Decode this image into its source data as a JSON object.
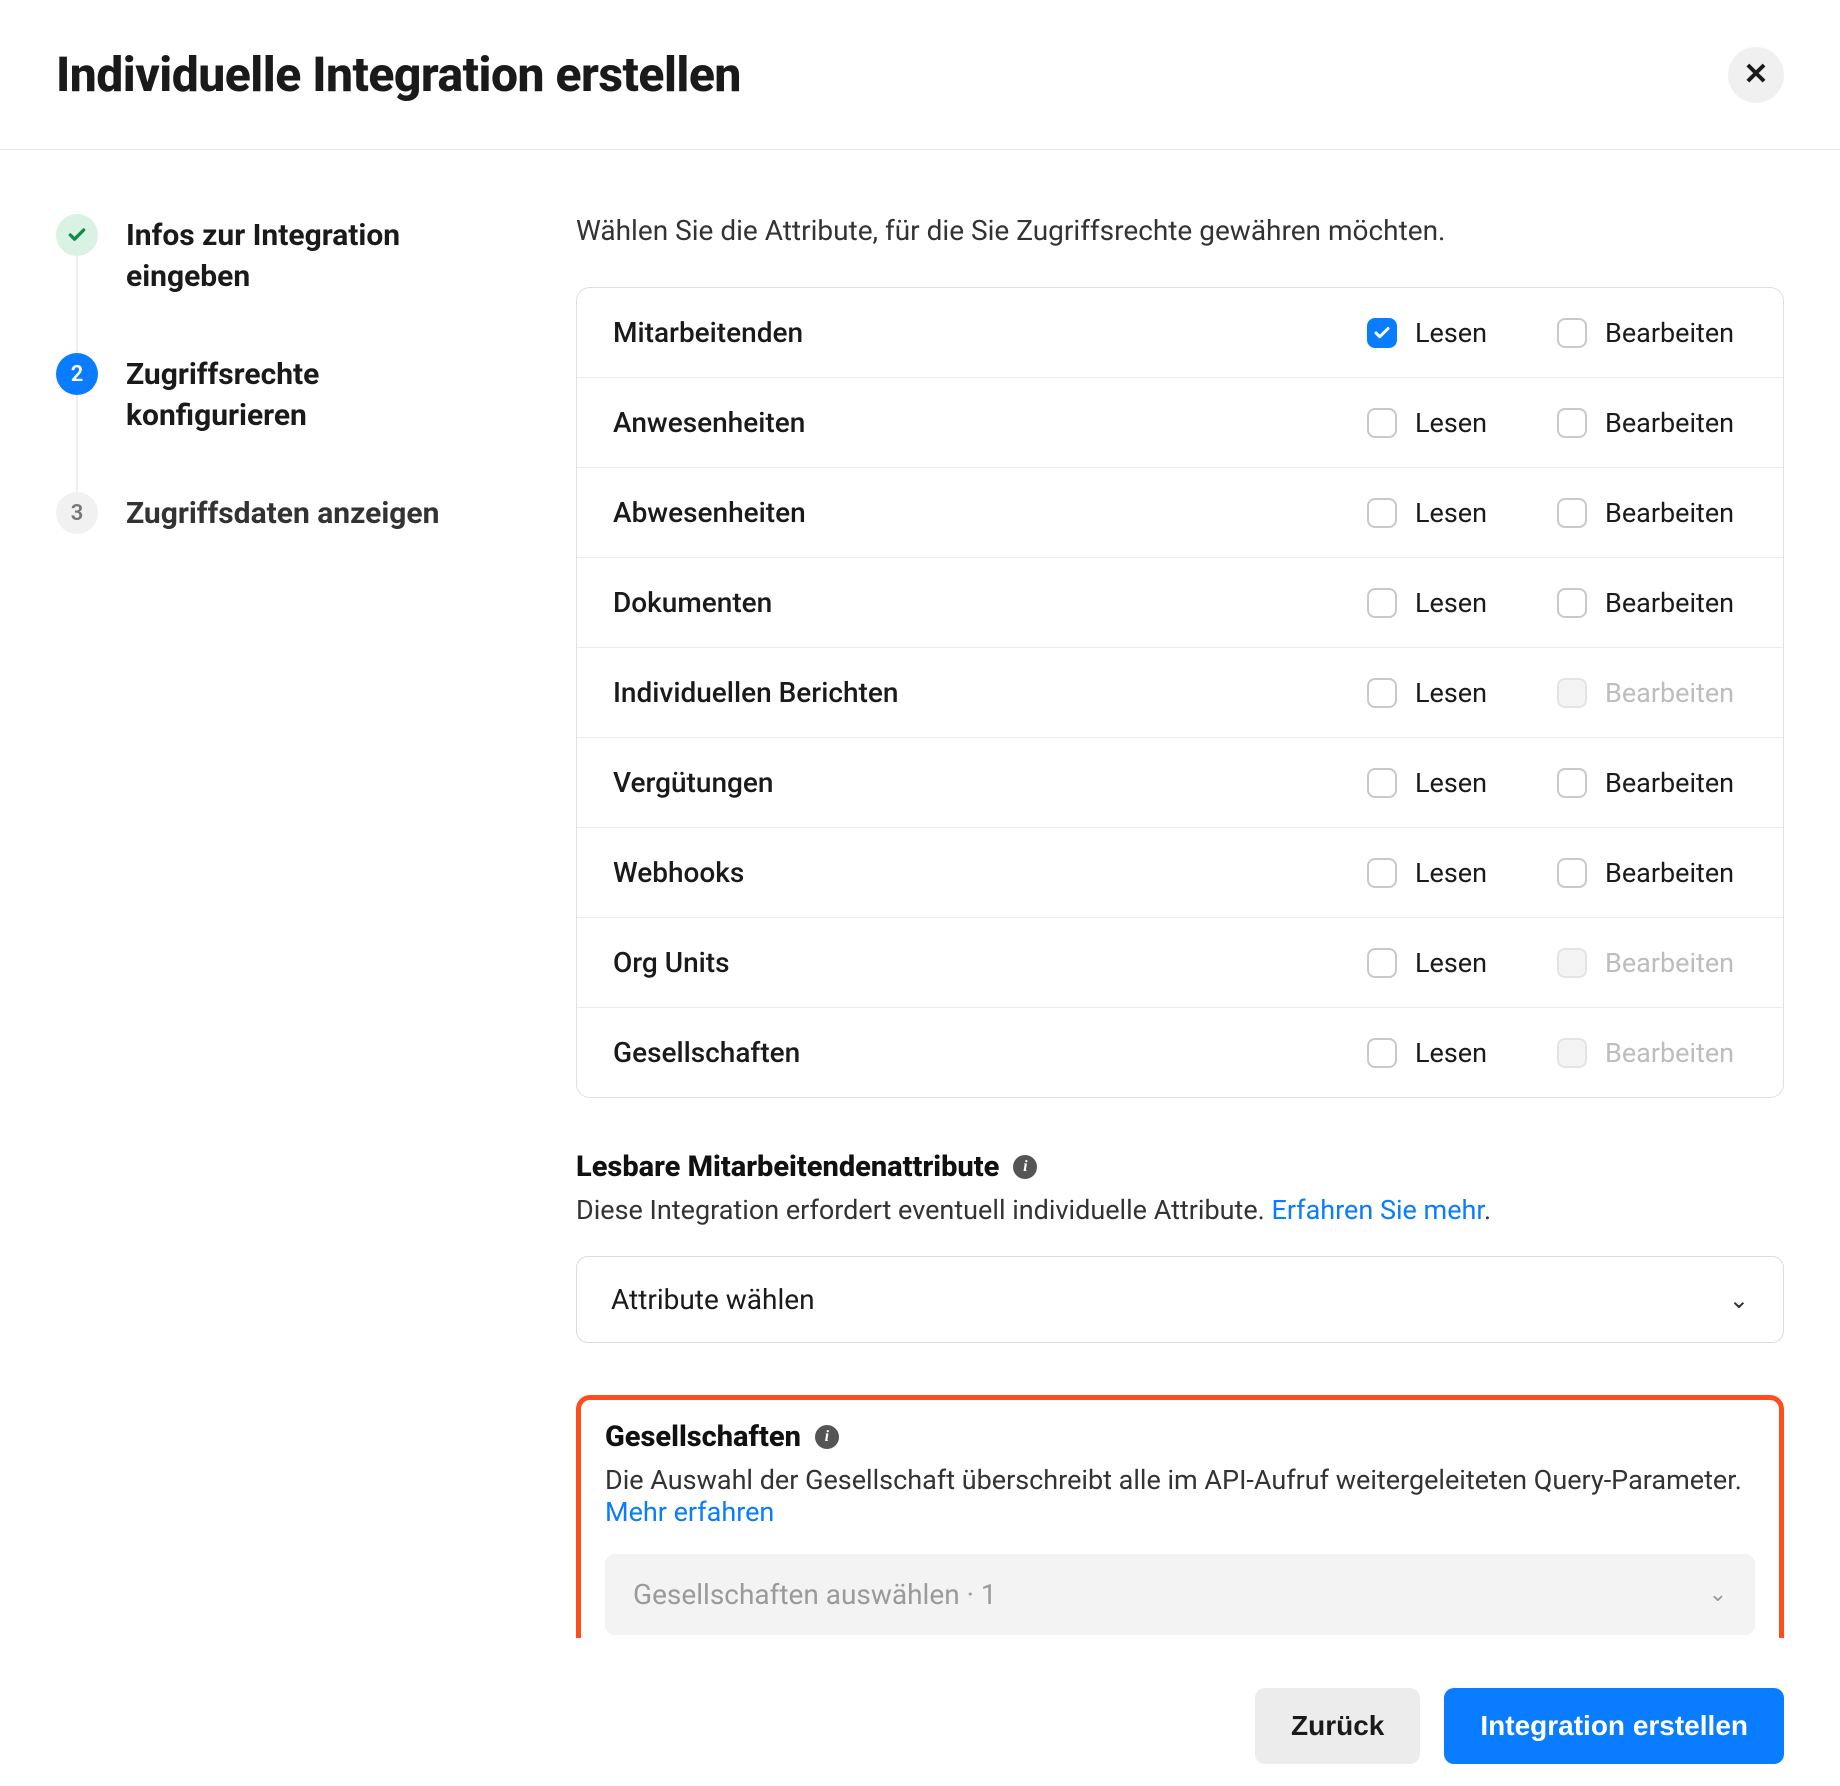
{
  "header": {
    "title": "Individuelle Integration erstellen"
  },
  "stepper": {
    "steps": [
      {
        "label": "Infos zur Integration eingeben",
        "state": "completed"
      },
      {
        "label": "Zugriffsrechte konfigurieren",
        "state": "active",
        "number": "2"
      },
      {
        "label": "Zugriffsdaten anzeigen",
        "state": "pending",
        "number": "3"
      }
    ]
  },
  "main": {
    "intro": "Wählen Sie die Attribute, für die Sie Zugriffsrechte gewähren möchten.",
    "read_label": "Lesen",
    "edit_label": "Bearbeiten",
    "permissions": [
      {
        "name": "Mitarbeitenden",
        "read_checked": true,
        "edit_checked": false,
        "edit_disabled": false
      },
      {
        "name": "Anwesenheiten",
        "read_checked": false,
        "edit_checked": false,
        "edit_disabled": false
      },
      {
        "name": "Abwesenheiten",
        "read_checked": false,
        "edit_checked": false,
        "edit_disabled": false
      },
      {
        "name": "Dokumenten",
        "read_checked": false,
        "edit_checked": false,
        "edit_disabled": false
      },
      {
        "name": "Individuellen Berichten",
        "read_checked": false,
        "edit_checked": false,
        "edit_disabled": true
      },
      {
        "name": "Vergütungen",
        "read_checked": false,
        "edit_checked": false,
        "edit_disabled": false
      },
      {
        "name": "Webhooks",
        "read_checked": false,
        "edit_checked": false,
        "edit_disabled": false
      },
      {
        "name": "Org Units",
        "read_checked": false,
        "edit_checked": false,
        "edit_disabled": true
      },
      {
        "name": "Gesellschaften",
        "read_checked": false,
        "edit_checked": false,
        "edit_disabled": true
      }
    ],
    "attributes": {
      "heading": "Lesbare Mitarbeitendenattribute",
      "desc": "Diese Integration erfordert eventuell individuelle Attribute. ",
      "link": "Erfahren Sie mehr",
      "select_placeholder": "Attribute wählen"
    },
    "companies": {
      "heading": "Gesellschaften",
      "desc": "Die Auswahl der Gesellschaft überschreibt alle im API-Aufruf weitergeleiteten Query-Parameter. ",
      "link": "Mehr erfahren",
      "select_placeholder": "Gesellschaften auswählen · 1"
    }
  },
  "footer": {
    "back": "Zurück",
    "create": "Integration erstellen"
  }
}
